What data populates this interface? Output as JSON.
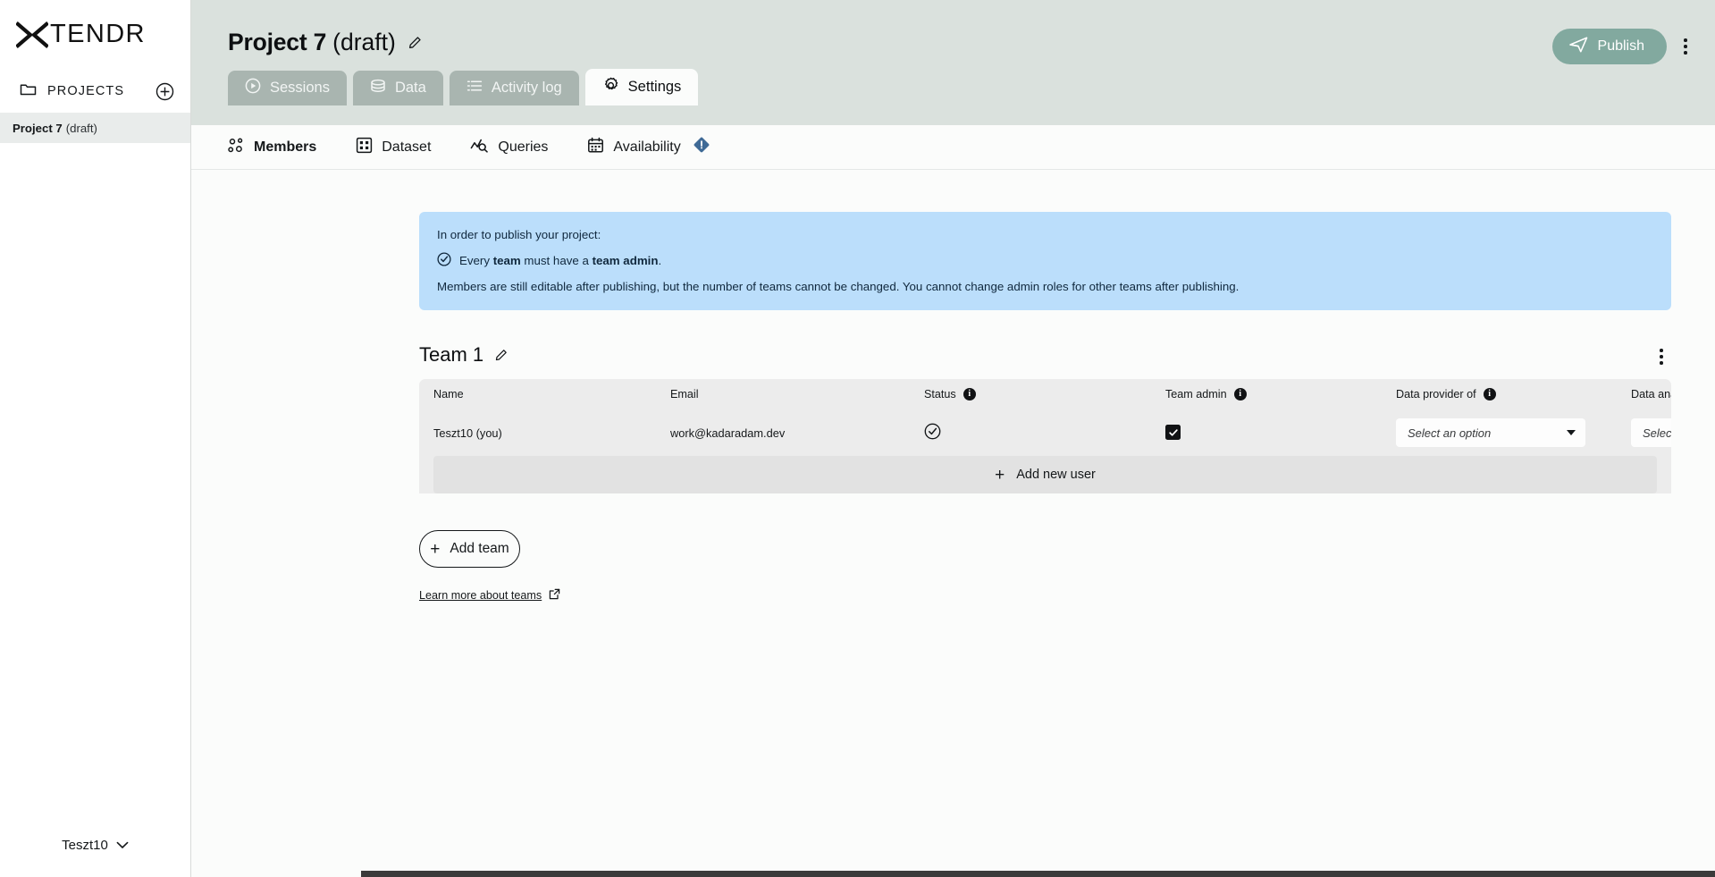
{
  "brand": {
    "name": "TENDR",
    "logo_icon": "x-logo-icon"
  },
  "sidebar": {
    "projects_label": "PROJECTS",
    "folder_icon": "folder-icon",
    "add_project_icon": "plus-circle-icon",
    "projects": [
      {
        "name": "Project 7",
        "status": "(draft)",
        "selected": true
      }
    ],
    "user": {
      "name": "Teszt10",
      "chevron_icon": "chevron-down-icon"
    }
  },
  "header": {
    "project_title": "Project 7",
    "project_status": "(draft)",
    "edit_icon": "pencil-icon",
    "publish_label": "Publish",
    "publish_icon": "send-icon",
    "publish_color": "#82a99f",
    "more_icon": "kebab-menu-icon",
    "background_color": "#dae1dd"
  },
  "tabs": [
    {
      "label": "Sessions",
      "icon": "play-circle-icon",
      "active": false
    },
    {
      "label": "Data",
      "icon": "database-icon",
      "active": false
    },
    {
      "label": "Activity log",
      "icon": "list-icon",
      "active": false
    },
    {
      "label": "Settings",
      "icon": "gear-icon",
      "active": true
    }
  ],
  "subnav": [
    {
      "label": "Members",
      "icon": "people-icon",
      "active": true,
      "warning": false
    },
    {
      "label": "Dataset",
      "icon": "grid-icon",
      "active": false,
      "warning": false
    },
    {
      "label": "Queries",
      "icon": "query-chart-icon",
      "active": false,
      "warning": false
    },
    {
      "label": "Availability",
      "icon": "calendar-icon",
      "active": false,
      "warning": true,
      "warning_icon": "warning-diamond-icon",
      "warning_color": "#3f6a96"
    }
  ],
  "banner": {
    "background_color": "#bbdefb",
    "line1": "In order to publish your project:",
    "check_icon": "check-circle-icon",
    "line2_prefix": "Every ",
    "line2_bold1": "team",
    "line2_middle": " must have a ",
    "line2_bold2": "team admin",
    "line2_suffix": ".",
    "line3": "Members are still editable after publishing, but the number of teams cannot be changed. You cannot change admin roles for other teams after publishing."
  },
  "team": {
    "name": "Team 1",
    "edit_icon": "pencil-icon",
    "menu_icon": "kebab-menu-icon",
    "columns": [
      {
        "key": "name",
        "label": "Name",
        "info": false
      },
      {
        "key": "email",
        "label": "Email",
        "info": false
      },
      {
        "key": "status",
        "label": "Status",
        "info": true
      },
      {
        "key": "team_admin",
        "label": "Team admin",
        "info": true
      },
      {
        "key": "data_provider",
        "label": "Data provider of",
        "info": true
      },
      {
        "key": "data_analyst",
        "label": "Data analyst of",
        "info": true
      }
    ],
    "rows": [
      {
        "name": "Teszt10 (you)",
        "email": "work@kadaradam.dev",
        "status_icon": "check-circle-icon",
        "team_admin_checked": true,
        "data_provider_value": "Select an option",
        "data_analyst_value": "Select an option",
        "row_menu_icon": "kebab-menu-icon"
      }
    ],
    "add_user_label": "Add new user",
    "add_user_icon": "plus-icon"
  },
  "footer_actions": {
    "add_team_label": "Add team",
    "add_team_icon": "plus-icon",
    "learn_more_label": "Learn more about teams",
    "external_link_icon": "external-link-icon"
  },
  "info_glyph": "i"
}
